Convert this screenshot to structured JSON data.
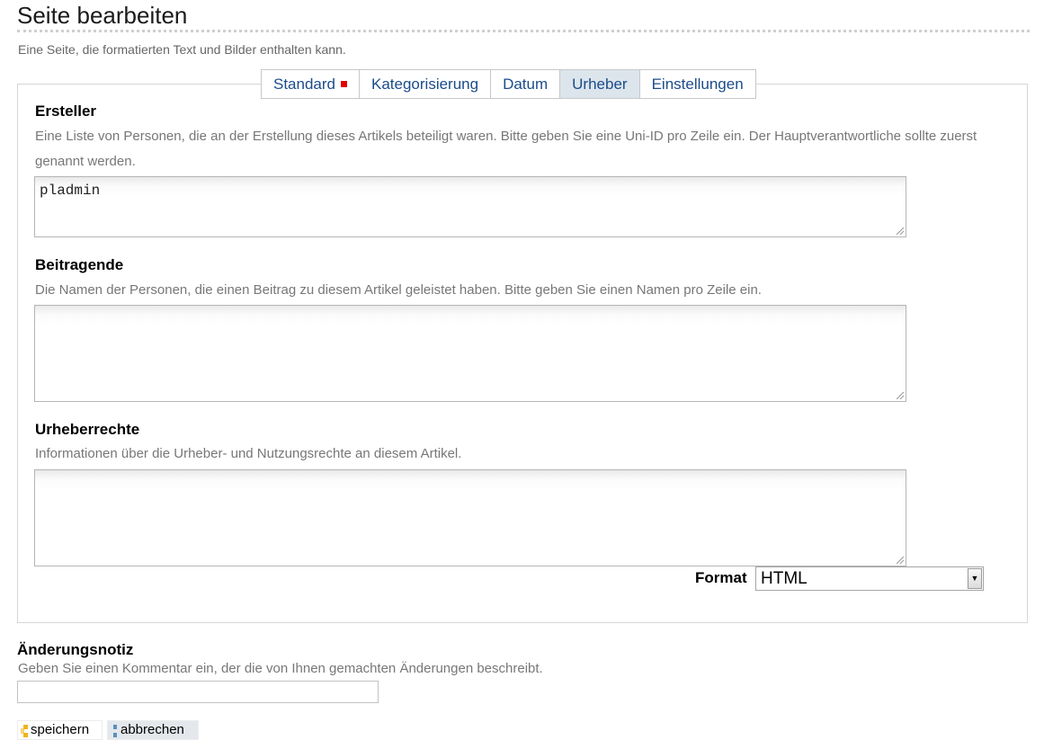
{
  "page": {
    "title": "Seite bearbeiten",
    "description": "Eine Seite, die formatierten Text und Bilder enthalten kann."
  },
  "tabs": [
    {
      "label": "Standard",
      "required_marker": true,
      "active": false
    },
    {
      "label": "Kategorisierung",
      "active": false
    },
    {
      "label": "Datum",
      "active": false
    },
    {
      "label": "Urheber",
      "active": true
    },
    {
      "label": "Einstellungen",
      "active": false
    }
  ],
  "fields": {
    "creators": {
      "label": "Ersteller",
      "help": "Eine Liste von Personen, die an der Erstellung dieses Artikels beteiligt waren. Bitte geben Sie eine Uni-ID pro Zeile ein. Der Hauptverantwortliche sollte zuerst genannt werden.",
      "value": "pladmin"
    },
    "contributors": {
      "label": "Beitragende",
      "help": "Die Namen der Personen, die einen Beitrag zu diesem Artikel geleistet haben. Bitte geben Sie einen Namen pro Zeile ein.",
      "value": ""
    },
    "rights": {
      "label": "Urheberrechte",
      "help": "Informationen über die Urheber- und Nutzungsrechte an diesem Artikel.",
      "value": ""
    },
    "format": {
      "label": "Format",
      "selected": "HTML"
    }
  },
  "change_note": {
    "label": "Änderungsnotiz",
    "help": "Geben Sie einen Kommentar ein, der die von Ihnen gemachten Änderungen beschreibt.",
    "value": ""
  },
  "buttons": {
    "save": "speichern",
    "cancel": "abbrechen"
  },
  "colors": {
    "tab_text": "#1b4c8a",
    "tab_active_bg": "#dde5ec",
    "required_marker": "#e00000"
  }
}
